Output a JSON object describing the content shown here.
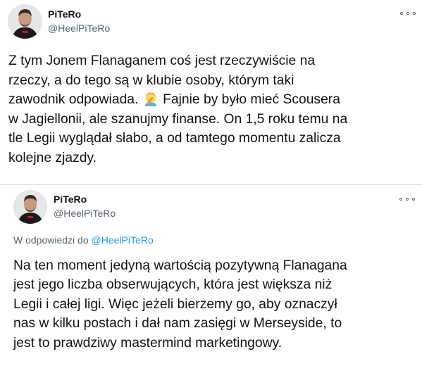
{
  "tweets": [
    {
      "author": {
        "name": "PiTeRo",
        "handle": "@HeelPiTeRo"
      },
      "more_icon": "more-horizontal-icon",
      "body_lines": [
        "Z tym Jonem Flanaganem coś jest rzeczywiście na",
        "rzeczy, a do tego są w klubie osoby, którym taki",
        "zawodnik odpowiada.",
        "Fajnie by było mieć Scousera",
        "w Jagiellonii, ale szanujmy finanse. On 1,5 roku temu na",
        "tle Legii wyglądał słabo, a od tamtego momentu zalicza",
        "kolejne zjazdy."
      ],
      "emoji": "man-facepalming-emoji"
    },
    {
      "author": {
        "name": "PiTeRo",
        "handle": "@HeelPiTeRo"
      },
      "more_icon": "more-horizontal-icon",
      "reply_to": {
        "prefix": "W odpowiedzi do",
        "handle": "@HeelPiTeRo"
      },
      "body_lines": [
        "Na ten moment jedyną wartością pozytywną Flanagana",
        "jest jego liczba obserwujących, która jest większa niż",
        "Legii i całej ligi. Więc jeżeli bierzemy go, aby oznaczył",
        "nas w kilku postach i dał nam zasięgi w Merseyside, to",
        "jest to prawdziwy mastermind marketingowy."
      ]
    }
  ],
  "colors": {
    "text": "#0f1419",
    "secondary": "#536471",
    "link": "#1d9bf0",
    "divider": "#cfd9de"
  }
}
